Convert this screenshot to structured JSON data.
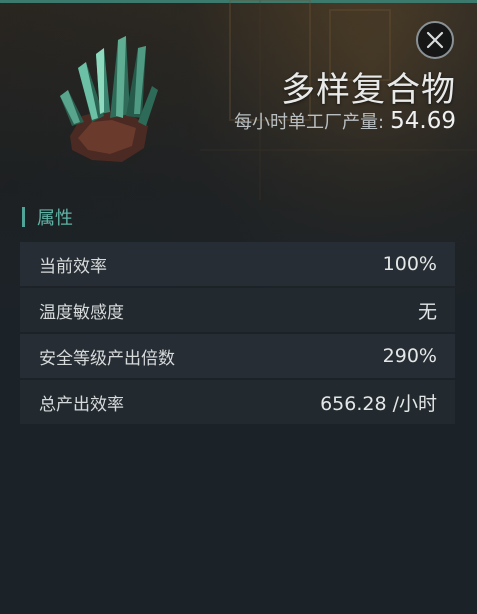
{
  "header": {
    "item_name": "多样复合物",
    "rate_label": "每小时单工厂产量:",
    "rate_value": "54.69"
  },
  "icons": {
    "close": "close-icon",
    "item": "crystal-icon"
  },
  "section": {
    "title": "属性"
  },
  "attributes": [
    {
      "label": "当前效率",
      "value": "100%"
    },
    {
      "label": "温度敏感度",
      "value": "无"
    },
    {
      "label": "安全等级产出倍数",
      "value": "290%"
    },
    {
      "label": "总产出效率",
      "value": "656.28 /小时"
    }
  ],
  "colors": {
    "accent": "#5fb3a6",
    "top_stripe": "#3d7a6e",
    "panel_bg": "#1c2328",
    "row_bg": "#282f35"
  }
}
